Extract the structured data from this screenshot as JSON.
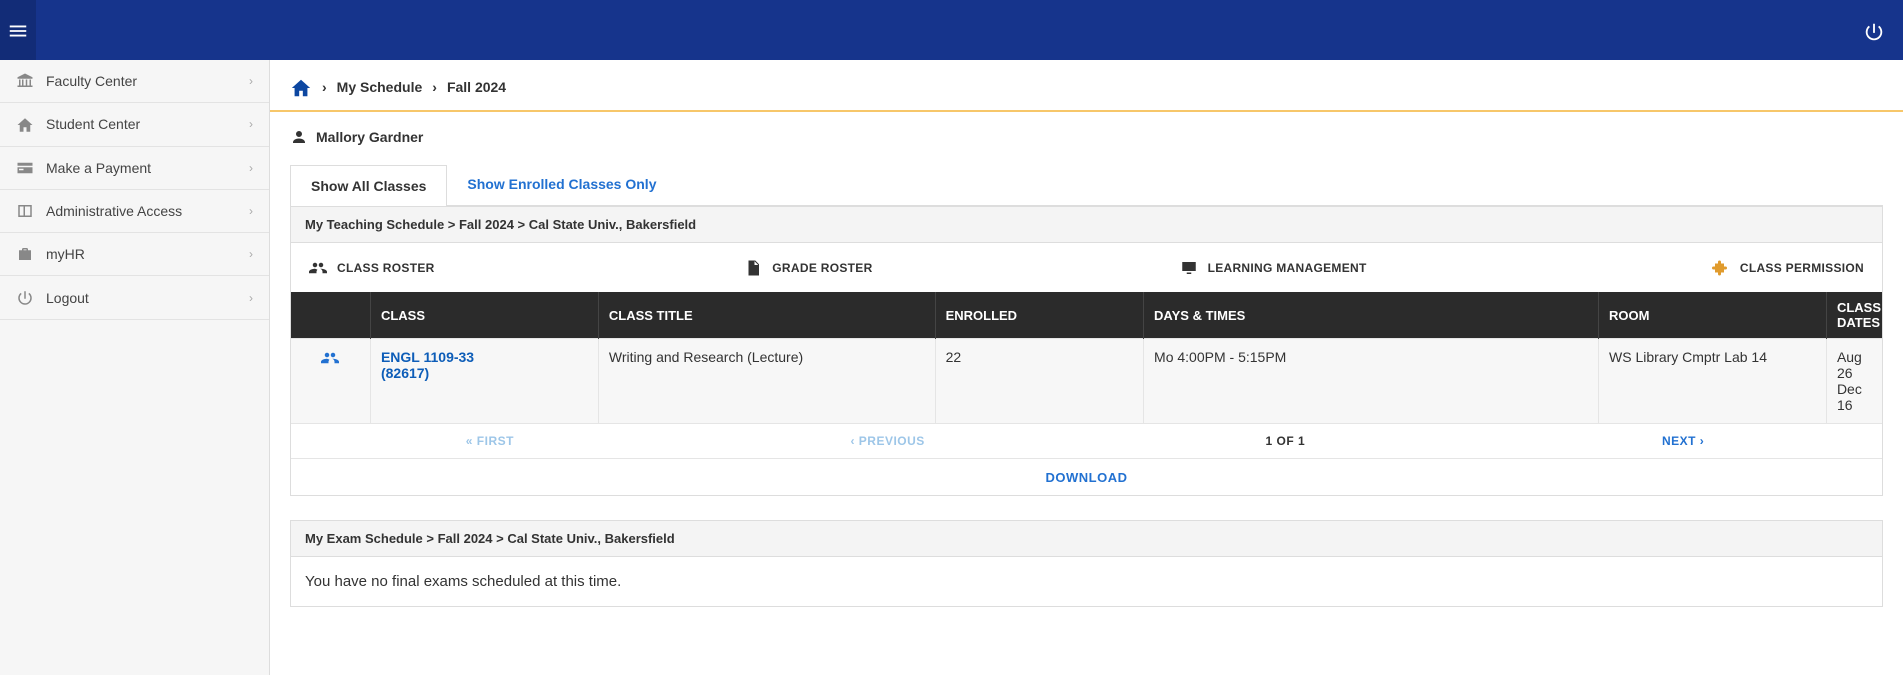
{
  "breadcrumb": {
    "item1": "My Schedule",
    "item2": "Fall 2024"
  },
  "user_name": "Mallory Gardner",
  "tabs": {
    "all": "Show All Classes",
    "enrolled": "Show Enrolled Classes Only"
  },
  "sidebar": {
    "items": [
      {
        "label": "Faculty Center",
        "icon": "bank-icon"
      },
      {
        "label": "Student Center",
        "icon": "home-icon"
      },
      {
        "label": "Make a Payment",
        "icon": "card-icon"
      },
      {
        "label": "Administrative Access",
        "icon": "panel-icon"
      },
      {
        "label": "myHR",
        "icon": "briefcase-icon"
      },
      {
        "label": "Logout",
        "icon": "power-icon"
      }
    ]
  },
  "schedule_header": "My Teaching Schedule > Fall 2024 > Cal State Univ., Bakersfield",
  "legend": {
    "roster": "CLASS ROSTER",
    "grade": "GRADE ROSTER",
    "lms": "LEARNING MANAGEMENT",
    "permission": "CLASS PERMISSION"
  },
  "columns": {
    "c0": "",
    "c1": "CLASS",
    "c2": "CLASS TITLE",
    "c3": "ENROLLED",
    "c4": "DAYS & TIMES",
    "c5": "ROOM",
    "c6": "CLASS DATES"
  },
  "rows": [
    {
      "class_code": "ENGL 1109-33",
      "class_nbr": "(82617)",
      "title": "Writing and Research (Lecture)",
      "enrolled": "22",
      "days": "Mo 4:00PM - 5:15PM",
      "room": "WS Library Cmptr Lab 14",
      "dates_l1": "Aug 26",
      "dates_l2": "Dec 16"
    }
  ],
  "pager": {
    "first": "« FIRST",
    "prev": "‹ PREVIOUS",
    "pos": "1 OF 1",
    "next": "NEXT ›",
    "download": "DOWNLOAD"
  },
  "exam_header": "My Exam Schedule > Fall 2024 > Cal State Univ., Bakersfield",
  "exam_msg": "You have no final exams scheduled at this time."
}
